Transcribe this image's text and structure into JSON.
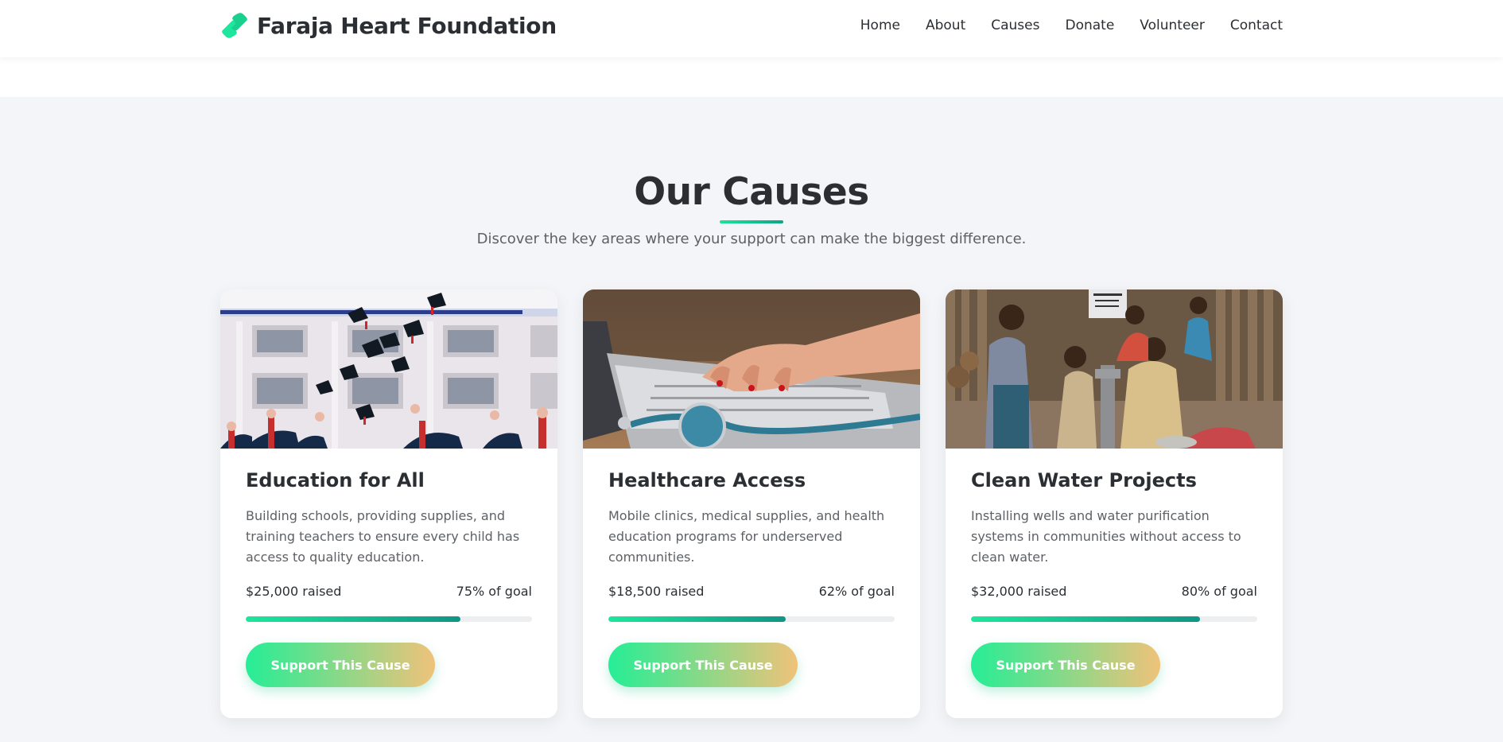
{
  "brand": {
    "name": "Faraja Heart Foundation",
    "icon": "hands-heart-icon",
    "accent": "#1ee69c"
  },
  "nav": [
    {
      "label": "Home"
    },
    {
      "label": "About"
    },
    {
      "label": "Causes"
    },
    {
      "label": "Donate"
    },
    {
      "label": "Volunteer"
    },
    {
      "label": "Contact"
    }
  ],
  "section": {
    "title": "Our Causes",
    "subtitle": "Discover the key areas where your support can make the biggest difference."
  },
  "causes": [
    {
      "title": "Education for All",
      "description": "Building schools, providing supplies, and training teachers to ensure every child has access to quality education.",
      "raised": "$25,000 raised",
      "goal_text": "75% of goal",
      "progress": 0.75,
      "button": "Support This Cause",
      "image": "graduation-caps-photo"
    },
    {
      "title": "Healthcare Access",
      "description": "Mobile clinics, medical supplies, and health education programs for underserved communities.",
      "raised": "$18,500 raised",
      "goal_text": "62% of goal",
      "progress": 0.62,
      "button": "Support This Cause",
      "image": "laptop-stethoscope-photo"
    },
    {
      "title": "Clean Water Projects",
      "description": "Installing wells and water purification systems in communities without access to clean water.",
      "raised": "$32,000 raised",
      "goal_text": "80% of goal",
      "progress": 0.8,
      "button": "Support This Cause",
      "image": "water-pump-photo"
    }
  ]
}
